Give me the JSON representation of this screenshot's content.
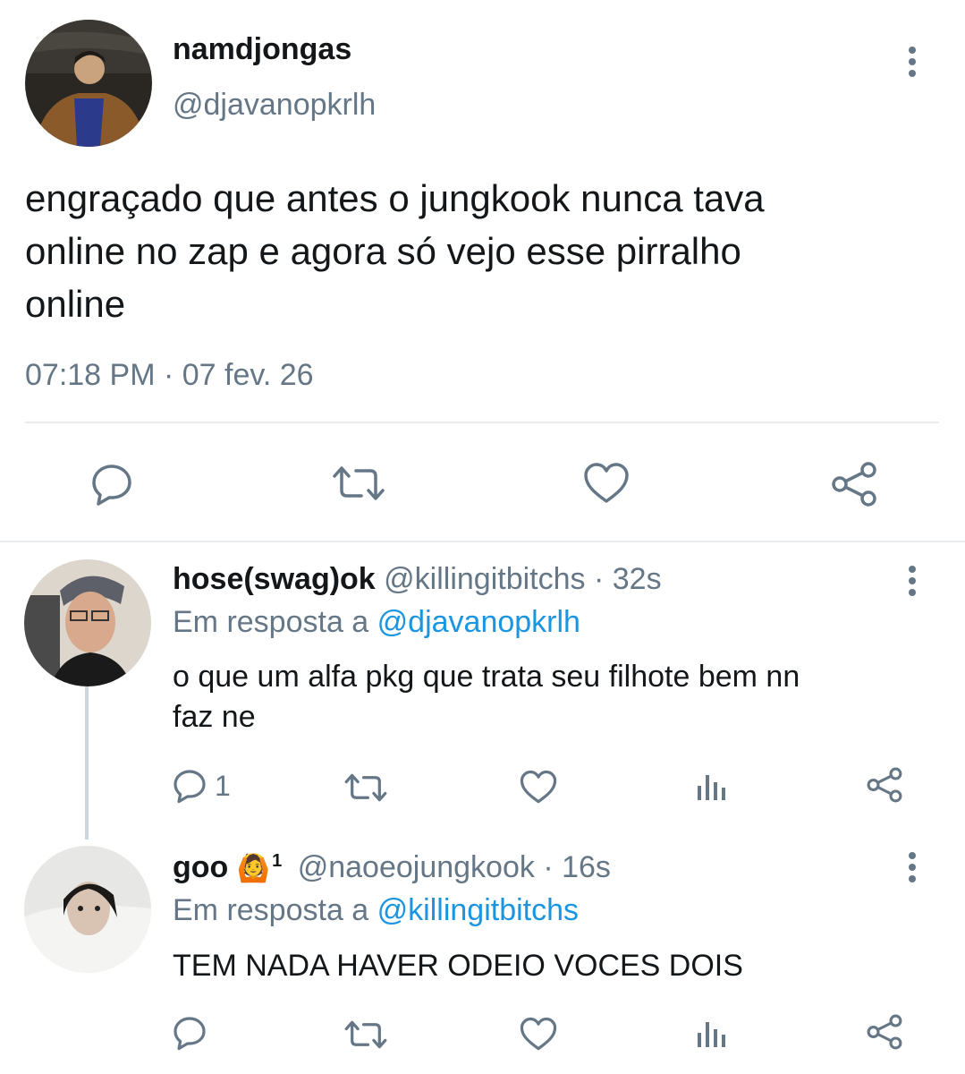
{
  "main_tweet": {
    "display_name": "namdjongas",
    "handle": "@djavanopkrlh",
    "text_lines": [
      "engraçado que antes o jungkook nunca tava",
      "online no zap e agora só vejo esse pirralho",
      "online"
    ],
    "timestamp": "07:18 PM · 07 fev. 26",
    "actions": [
      "reply-icon",
      "retweet-icon",
      "like-icon",
      "share-icon"
    ]
  },
  "replies": [
    {
      "display_name": "hose(swag)ok",
      "handle": "@killingitbitchs",
      "time": "· 32s",
      "replying_prefix": "Em resposta a ",
      "replying_to": "@djavanopkrlh",
      "text_lines": [
        "o que um alfa pkg que trata seu filhote bem nn",
        "faz ne"
      ],
      "reply_count": "1"
    },
    {
      "display_name": "goo",
      "emoji": "🙆",
      "badge": "1",
      "handle": "@naoeojungkook",
      "time": "· 16s",
      "replying_prefix": "Em resposta a ",
      "replying_to": "@killingitbitchs",
      "text_lines": [
        "TEM NADA HAVER ODEIO VOCES DOIS"
      ]
    }
  ],
  "colors": {
    "accent": "#1b95e0",
    "muted": "#657786",
    "border": "#e6ecf0"
  }
}
